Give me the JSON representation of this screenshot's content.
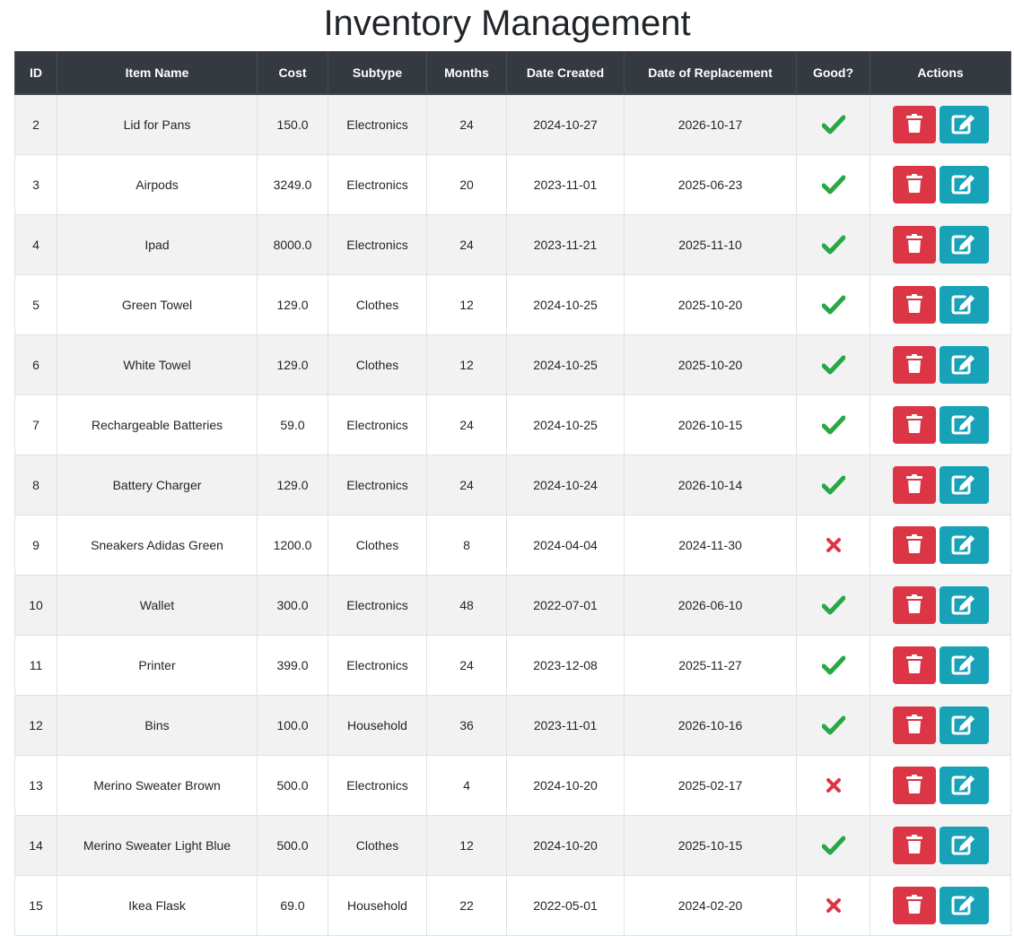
{
  "page": {
    "title": "Inventory Management"
  },
  "colors": {
    "header_bg": "#343a40",
    "delete": "#dc3545",
    "edit": "#17a2b8",
    "good": "#28a745",
    "bad": "#dc3545",
    "stripe": "#f2f2f2"
  },
  "table": {
    "headers": [
      "ID",
      "Item Name",
      "Cost",
      "Subtype",
      "Months",
      "Date Created",
      "Date of Replacement",
      "Good?",
      "Actions"
    ],
    "rows": [
      {
        "id": "2",
        "name": "Lid for Pans",
        "cost": "150.0",
        "subtype": "Electronics",
        "months": "24",
        "created": "2024-10-27",
        "replacement": "2026-10-17",
        "good": true
      },
      {
        "id": "3",
        "name": "Airpods",
        "cost": "3249.0",
        "subtype": "Electronics",
        "months": "20",
        "created": "2023-11-01",
        "replacement": "2025-06-23",
        "good": true
      },
      {
        "id": "4",
        "name": "Ipad",
        "cost": "8000.0",
        "subtype": "Electronics",
        "months": "24",
        "created": "2023-11-21",
        "replacement": "2025-11-10",
        "good": true
      },
      {
        "id": "5",
        "name": "Green Towel",
        "cost": "129.0",
        "subtype": "Clothes",
        "months": "12",
        "created": "2024-10-25",
        "replacement": "2025-10-20",
        "good": true
      },
      {
        "id": "6",
        "name": "White Towel",
        "cost": "129.0",
        "subtype": "Clothes",
        "months": "12",
        "created": "2024-10-25",
        "replacement": "2025-10-20",
        "good": true
      },
      {
        "id": "7",
        "name": "Rechargeable Batteries",
        "cost": "59.0",
        "subtype": "Electronics",
        "months": "24",
        "created": "2024-10-25",
        "replacement": "2026-10-15",
        "good": true
      },
      {
        "id": "8",
        "name": "Battery Charger",
        "cost": "129.0",
        "subtype": "Electronics",
        "months": "24",
        "created": "2024-10-24",
        "replacement": "2026-10-14",
        "good": true
      },
      {
        "id": "9",
        "name": "Sneakers Adidas Green",
        "cost": "1200.0",
        "subtype": "Clothes",
        "months": "8",
        "created": "2024-04-04",
        "replacement": "2024-11-30",
        "good": false
      },
      {
        "id": "10",
        "name": "Wallet",
        "cost": "300.0",
        "subtype": "Electronics",
        "months": "48",
        "created": "2022-07-01",
        "replacement": "2026-06-10",
        "good": true
      },
      {
        "id": "11",
        "name": "Printer",
        "cost": "399.0",
        "subtype": "Electronics",
        "months": "24",
        "created": "2023-12-08",
        "replacement": "2025-11-27",
        "good": true
      },
      {
        "id": "12",
        "name": "Bins",
        "cost": "100.0",
        "subtype": "Household",
        "months": "36",
        "created": "2023-11-01",
        "replacement": "2026-10-16",
        "good": true
      },
      {
        "id": "13",
        "name": "Merino Sweater Brown",
        "cost": "500.0",
        "subtype": "Electronics",
        "months": "4",
        "created": "2024-10-20",
        "replacement": "2025-02-17",
        "good": false
      },
      {
        "id": "14",
        "name": "Merino Sweater Light Blue",
        "cost": "500.0",
        "subtype": "Clothes",
        "months": "12",
        "created": "2024-10-20",
        "replacement": "2025-10-15",
        "good": true
      },
      {
        "id": "15",
        "name": "Ikea Flask",
        "cost": "69.0",
        "subtype": "Household",
        "months": "22",
        "created": "2022-05-01",
        "replacement": "2024-02-20",
        "good": false
      }
    ]
  },
  "icons": {
    "good": "check-icon",
    "bad": "cross-icon",
    "delete": "trash-icon",
    "edit": "edit-icon"
  }
}
